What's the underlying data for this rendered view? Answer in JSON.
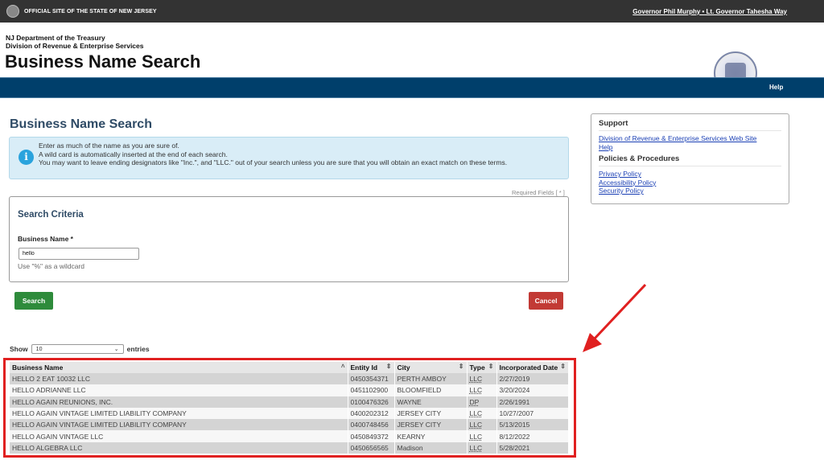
{
  "topbar": {
    "official_text": "OFFICIAL SITE OF THE STATE OF NEW JERSEY",
    "governor_link": "Governor Phil Murphy • Lt. Governor Tahesha Way"
  },
  "header": {
    "dept_line1": "NJ Department of the Treasury",
    "dept_line2": "Division of Revenue & Enterprise Services",
    "title": "Business Name Search"
  },
  "nav": {
    "help": "Help"
  },
  "main": {
    "title": "Business Name Search",
    "info": {
      "icon": "info-icon",
      "lines": [
        "Enter as much of the name as you are sure of.",
        "A wild card is automatically inserted at the end of each search.",
        "You may want to leave ending designators like \"Inc.\", and \"LLC.\" out of your search unless you are sure that you will obtain an exact match on these terms."
      ]
    },
    "required_fields": "Required Fields [ * ]",
    "criteria": {
      "heading": "Search Criteria",
      "label": "Business Name *",
      "value": "hello",
      "hint": "Use \"%\" as a wildcard"
    },
    "buttons": {
      "search": "Search",
      "cancel": "Cancel"
    },
    "show": {
      "label": "Show",
      "value": "10",
      "suffix": "entries"
    }
  },
  "table": {
    "columns": [
      "Business Name",
      "Entity Id",
      "City",
      "Type",
      "Incorporated Date"
    ],
    "rows": [
      [
        "HELLO 2 EAT 10032 LLC",
        "0450354371",
        "PERTH AMBOY",
        "LLC",
        "2/27/2019"
      ],
      [
        "HELLO ADRIANNE LLC",
        "0451102900",
        "BLOOMFIELD",
        "LLC",
        "3/20/2024"
      ],
      [
        "HELLO AGAIN REUNIONS, INC.",
        "0100476326",
        "WAYNE",
        "DP",
        "2/26/1991"
      ],
      [
        "HELLO AGAIN VINTAGE LIMITED LIABILITY COMPANY",
        "0400202312",
        "JERSEY CITY",
        "LLC",
        "10/27/2007"
      ],
      [
        "HELLO AGAIN VINTAGE LIMITED LIABILITY COMPANY",
        "0400748456",
        "JERSEY CITY",
        "LLC",
        "5/13/2015"
      ],
      [
        "HELLO AGAIN VINTAGE LLC",
        "0450849372",
        "KEARNY",
        "LLC",
        "8/12/2022"
      ],
      [
        "HELLO ALGEBRA LLC",
        "0450656565",
        "Madison",
        "LLC",
        "5/28/2021"
      ]
    ]
  },
  "sidebar": {
    "support_heading": "Support",
    "support_links": [
      "Division of Revenue & Enterprise Services Web Site",
      "Help"
    ],
    "policies_heading": "Policies & Procedures",
    "policy_links": [
      "Privacy Policy",
      "Accessibility Policy",
      "Security Policy"
    ]
  },
  "annotation": {
    "color": "#e02020"
  }
}
